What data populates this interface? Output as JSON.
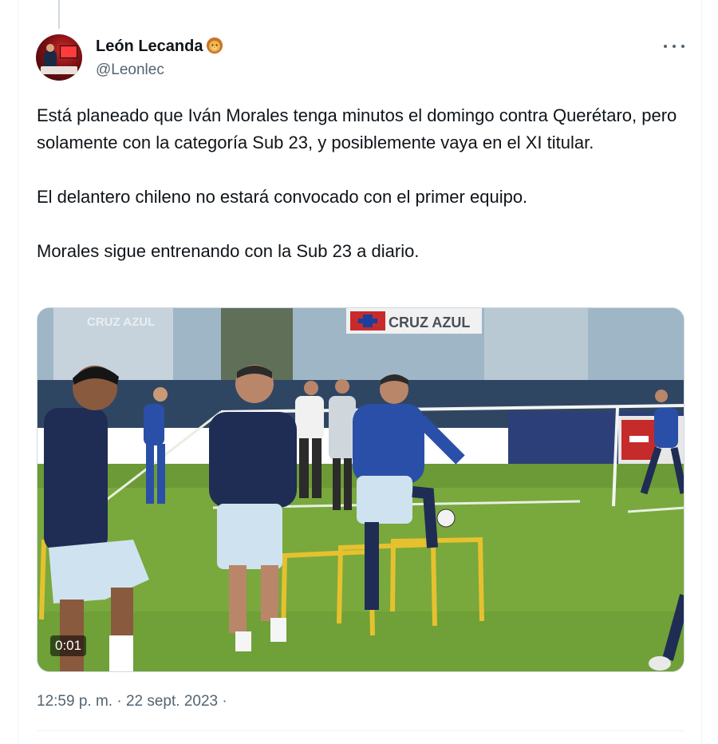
{
  "author": {
    "display_name": "León Lecanda",
    "handle": "@Leonlec",
    "badge_icon": "lion-face-emoji"
  },
  "tweet": {
    "paragraphs": [
      "Está planeado que Iván Morales tenga minutos el domingo contra Querétaro, pero solamente con la categoría Sub 23, y posiblemente vaya en el XI titular.",
      "El delantero chileno no estará convocado con el primer equipo.",
      "Morales sigue entrenando con la Sub 23 a diario."
    ],
    "timestamp": "12:59 p. m. · 22 sept. 2023 ·"
  },
  "media": {
    "type": "video",
    "elapsed": "0:01",
    "wall_text_left": "CRUZ AZUL",
    "banner_text": "CRUZ AZUL",
    "colors": {
      "grass": "#79a83d",
      "kit_dark": "#1f2d55",
      "kit_blue": "#2a4fa8",
      "hurdle": "#e6c12f"
    }
  },
  "icons": {
    "more": "more-horizontal-icon"
  }
}
